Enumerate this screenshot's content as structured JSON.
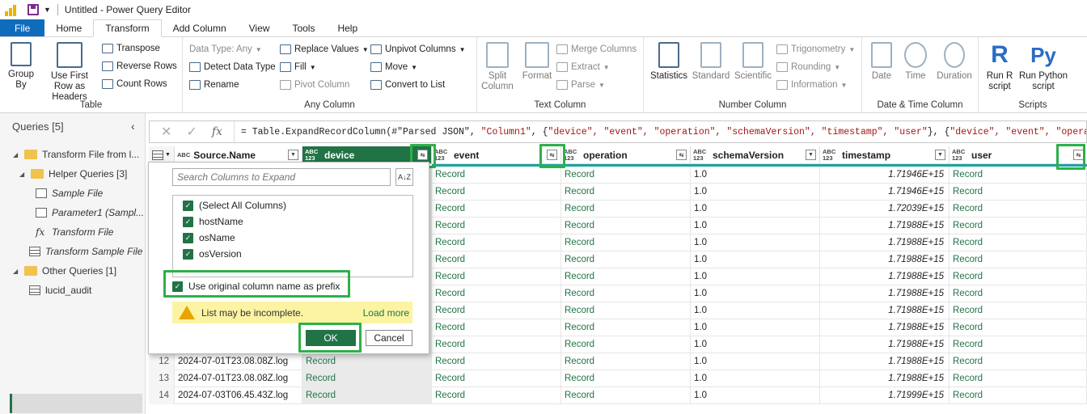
{
  "window": {
    "title": "Untitled - Power Query Editor"
  },
  "tabs": [
    {
      "label": "File"
    },
    {
      "label": "Home"
    },
    {
      "label": "Transform"
    },
    {
      "label": "Add Column"
    },
    {
      "label": "View"
    },
    {
      "label": "Tools"
    },
    {
      "label": "Help"
    }
  ],
  "ribbon": {
    "table": {
      "label": "Table",
      "group_by": "Group By",
      "use_first_row": "Use First Row as Headers",
      "transpose": "Transpose",
      "reverse_rows": "Reverse Rows",
      "count_rows": "Count Rows"
    },
    "any_column": {
      "label": "Any Column",
      "data_type": "Data Type: Any",
      "detect_data_type": "Detect Data Type",
      "rename": "Rename",
      "replace_values": "Replace Values",
      "fill": "Fill",
      "pivot_column": "Pivot Column",
      "unpivot_columns": "Unpivot Columns",
      "move": "Move",
      "convert_to_list": "Convert to List"
    },
    "text_column": {
      "label": "Text Column",
      "split_column": "Split Column",
      "format": "Format",
      "merge_columns": "Merge Columns",
      "extract": "Extract",
      "parse": "Parse"
    },
    "number_column": {
      "label": "Number Column",
      "statistics": "Statistics",
      "standard": "Standard",
      "scientific": "Scientific",
      "trigonometry": "Trigonometry",
      "rounding": "Rounding",
      "information": "Information"
    },
    "date_time_column": {
      "label": "Date & Time Column",
      "date": "Date",
      "time": "Time",
      "duration": "Duration"
    },
    "scripts": {
      "label": "Scripts",
      "run_r": "Run R script",
      "run_python": "Run Python script"
    }
  },
  "formula": {
    "prefix": "= Table.ExpandRecordColumn(#\"Parsed JSON\", ",
    "s1": "\"Column1\"",
    "mid1": ", {",
    "l1": "\"device\", \"event\", \"operation\", \"schemaVersion\", \"timestamp\", \"user\"",
    "mid2": "}, {",
    "l2": "\"device\", \"event\", \"operation\""
  },
  "queries": {
    "header": "Queries [5]",
    "items": [
      {
        "label": "Transform File from l..."
      },
      {
        "label": "Helper Queries [3]"
      },
      {
        "label": "Sample File"
      },
      {
        "label": "Parameter1 (Sampl..."
      },
      {
        "label": "Transform File"
      },
      {
        "label": "Transform Sample File"
      },
      {
        "label": "Other Queries [1]"
      },
      {
        "label": "lucid_audit"
      }
    ]
  },
  "grid": {
    "columns": [
      {
        "name": "Source.Name",
        "type": "ABC"
      },
      {
        "name": "device",
        "type": "ABC 123"
      },
      {
        "name": "event",
        "type": "ABC 123"
      },
      {
        "name": "operation",
        "type": "ABC 123"
      },
      {
        "name": "schemaVersion",
        "type": "ABC 123"
      },
      {
        "name": "timestamp",
        "type": "ABC 123"
      },
      {
        "name": "user",
        "type": "ABC 123"
      }
    ],
    "rows": [
      {
        "n": "",
        "src": "",
        "device": "",
        "event": "Record",
        "operation": "Record",
        "schema": "1.0",
        "ts": "1.71946E+15",
        "user": "Record"
      },
      {
        "n": "",
        "src": "",
        "device": "",
        "event": "Record",
        "operation": "Record",
        "schema": "1.0",
        "ts": "1.71946E+15",
        "user": "Record"
      },
      {
        "n": "",
        "src": "",
        "device": "",
        "event": "Record",
        "operation": "Record",
        "schema": "1.0",
        "ts": "1.72039E+15",
        "user": "Record"
      },
      {
        "n": "",
        "src": "",
        "device": "",
        "event": "Record",
        "operation": "Record",
        "schema": "1.0",
        "ts": "1.71988E+15",
        "user": "Record"
      },
      {
        "n": "",
        "src": "",
        "device": "",
        "event": "Record",
        "operation": "Record",
        "schema": "1.0",
        "ts": "1.71988E+15",
        "user": "Record"
      },
      {
        "n": "",
        "src": "",
        "device": "",
        "event": "Record",
        "operation": "Record",
        "schema": "1.0",
        "ts": "1.71988E+15",
        "user": "Record"
      },
      {
        "n": "",
        "src": "",
        "device": "",
        "event": "Record",
        "operation": "Record",
        "schema": "1.0",
        "ts": "1.71988E+15",
        "user": "Record"
      },
      {
        "n": "",
        "src": "",
        "device": "",
        "event": "Record",
        "operation": "Record",
        "schema": "1.0",
        "ts": "1.71988E+15",
        "user": "Record"
      },
      {
        "n": "",
        "src": "",
        "device": "",
        "event": "Record",
        "operation": "Record",
        "schema": "1.0",
        "ts": "1.71988E+15",
        "user": "Record"
      },
      {
        "n": "",
        "src": "",
        "device": "",
        "event": "Record",
        "operation": "Record",
        "schema": "1.0",
        "ts": "1.71988E+15",
        "user": "Record"
      },
      {
        "n": "",
        "src": "",
        "device": "",
        "event": "Record",
        "operation": "Record",
        "schema": "1.0",
        "ts": "1.71988E+15",
        "user": "Record"
      },
      {
        "n": "12",
        "src": "2024-07-01T23.08.08Z.log",
        "device": "Record",
        "event": "Record",
        "operation": "Record",
        "schema": "1.0",
        "ts": "1.71988E+15",
        "user": "Record"
      },
      {
        "n": "13",
        "src": "2024-07-01T23.08.08Z.log",
        "device": "Record",
        "event": "Record",
        "operation": "Record",
        "schema": "1.0",
        "ts": "1.71988E+15",
        "user": "Record"
      },
      {
        "n": "14",
        "src": "2024-07-03T06.45.43Z.log",
        "device": "Record",
        "event": "Record",
        "operation": "Record",
        "schema": "1.0",
        "ts": "1.71999E+15",
        "user": "Record"
      }
    ]
  },
  "expand_popup": {
    "search_placeholder": "Search Columns to Expand",
    "sort_icon_text": "A↓Z",
    "options": [
      {
        "label": "(Select All Columns)",
        "checked": true
      },
      {
        "label": "hostName",
        "checked": true
      },
      {
        "label": "osName",
        "checked": true
      },
      {
        "label": "osVersion",
        "checked": true
      }
    ],
    "prefix_option": "Use original column name as prefix",
    "warning": "List may be incomplete.",
    "load_more": "Load more",
    "ok": "OK",
    "cancel": "Cancel"
  },
  "colors": {
    "accent": "#217346",
    "file_tab": "#0f6cbd",
    "highlight": "#2db04a",
    "teal_line": "#1aa3a3"
  }
}
